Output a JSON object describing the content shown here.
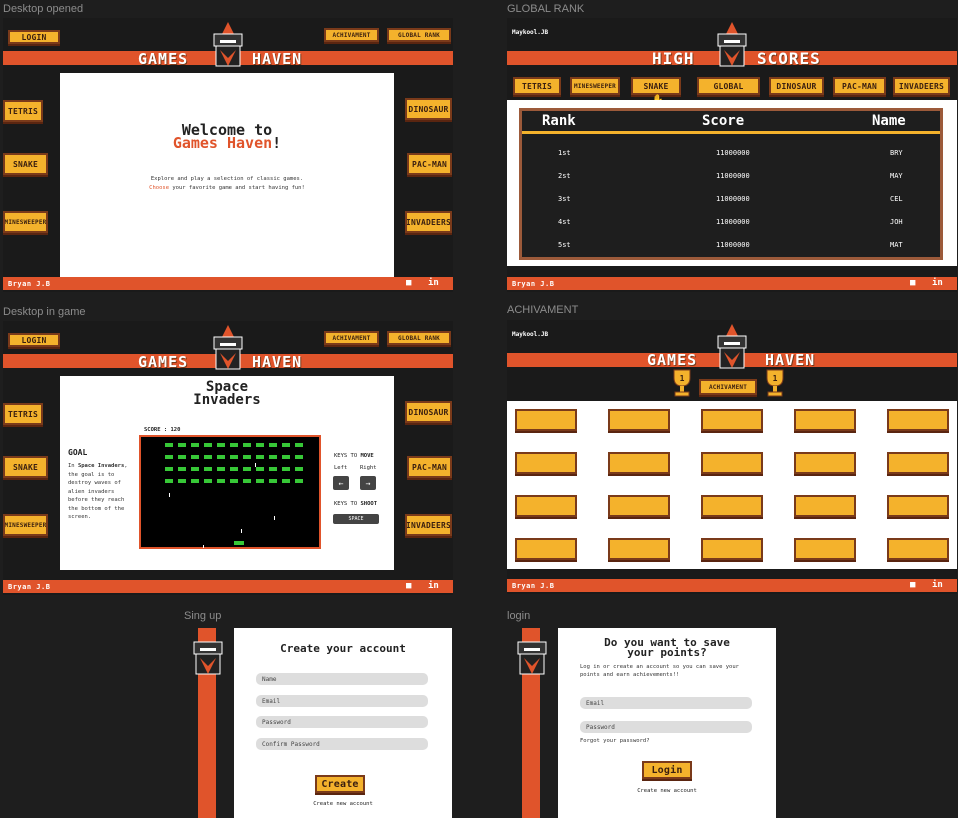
{
  "frames": {
    "desktop_opened": "Desktop opened",
    "global_rank": "GLOBAL RANK",
    "desktop_in_game": "Desktop in game",
    "achivament": "ACHIVAMENT",
    "sign_up": "Sing up",
    "login": "login"
  },
  "nav": {
    "login": "LOGIN",
    "achivament": "ACHIVAMENT",
    "global_rank": "GLOBAL RANK",
    "logo_left": "GAMES",
    "logo_right": "HAVEN"
  },
  "games": {
    "tetris": "TETRIS",
    "snake": "SNAKE",
    "minesweeper": "MINESWEEPER",
    "dinosaur": "DINOSAUR",
    "pacman": "PAC-MAN",
    "invadeers": "INVADEERS"
  },
  "welcome": {
    "line1": "Welcome to",
    "line2_accent": "Games Haven",
    "line2_end": "!",
    "desc1": "Explore and play a selection of classic games.",
    "desc2_accent": "Choose",
    "desc2_rest": " your favorite game and start having fun!"
  },
  "footer": {
    "author": "Bryan J.B",
    "icon1": "■",
    "icon2": "in"
  },
  "rank": {
    "user": "Maykool.JB",
    "title_left": "HIGH",
    "title_right": "SCORES",
    "filter_global": "GLOBAL",
    "col_rank": "Rank",
    "col_score": "Score",
    "col_name": "Name",
    "rows": [
      {
        "rank": "1st",
        "score": "11000000",
        "name": "BRY"
      },
      {
        "rank": "2st",
        "score": "11000000",
        "name": "MAY"
      },
      {
        "rank": "3st",
        "score": "11000000",
        "name": "CEL"
      },
      {
        "rank": "4st",
        "score": "11000000",
        "name": "JOH"
      },
      {
        "rank": "5st",
        "score": "11000000",
        "name": "MAT"
      }
    ]
  },
  "ingame": {
    "title1": "Space",
    "title2": "Invaders",
    "score": "SCORE : 120",
    "goal_title": "GOAL",
    "goal_pre": "In ",
    "goal_bold": "Space Invaders",
    "goal_rest": ", the goal is to destroy waves of alien invaders before they reach the bottom of the screen.",
    "keys_move_pre": "KEYS TO ",
    "keys_move": "MOVE",
    "left": "Left",
    "right": "Right",
    "left_arrow": "←",
    "right_arrow": "→",
    "keys_shoot_pre": "KEYS TO ",
    "keys_shoot": "SHOOT",
    "space": "SPACE"
  },
  "achievements": {
    "user": "Maykool.JB",
    "button": "ACHIVAMENT",
    "trophy1": "1",
    "trophy2": "1"
  },
  "signup": {
    "title": "Create your account",
    "name": "Name",
    "email": "Email",
    "password": "Password",
    "confirm": "Confirm Password",
    "create": "Create",
    "link": "Create new account"
  },
  "loginform": {
    "title1": "Do you want to save",
    "title2": "your points?",
    "desc1": "Log in or create an account so you can save your",
    "desc2": "points and earn achievements!!",
    "email": "Email",
    "password": "Password",
    "forgot": "Forgot your password?",
    "login": "Login",
    "link": "Create new account"
  },
  "colors": {
    "accent": "#e0542b",
    "button": "#f4b22c",
    "button_border": "#7a3a1a",
    "dark": "#1a1a1a"
  }
}
